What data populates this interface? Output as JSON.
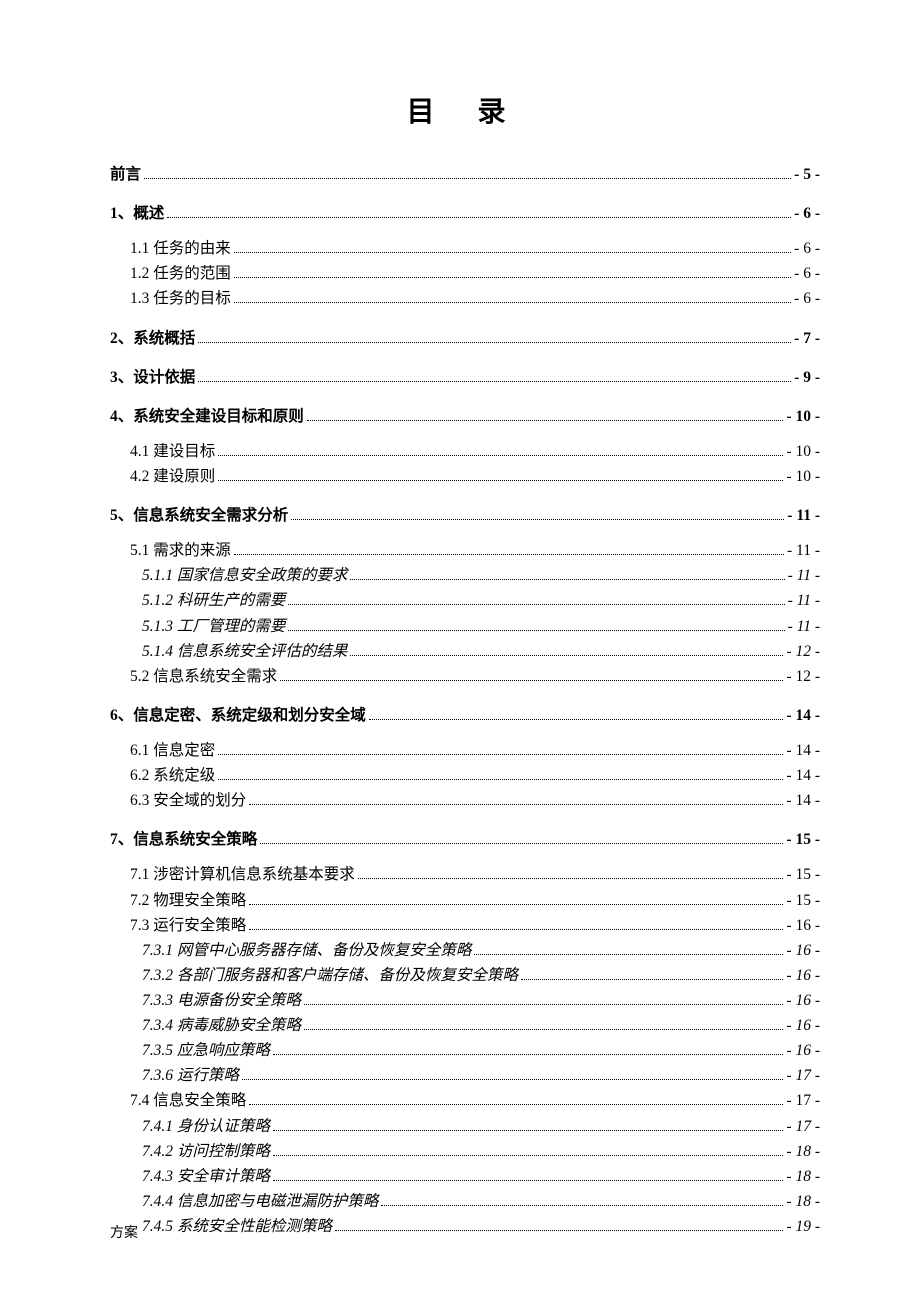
{
  "title": "目 录",
  "footer": "方案",
  "entries": [
    {
      "level": 0,
      "label": "前言",
      "page": "- 5 -",
      "gap": false
    },
    {
      "level": 0,
      "label": "1、概述",
      "page": "- 6 -",
      "gap": false
    },
    {
      "level": 1,
      "label": "1.1 任务的由来",
      "page": "- 6 -",
      "gap": true
    },
    {
      "level": 1,
      "label": "1.2 任务的范围",
      "page": "- 6 -",
      "gap": false
    },
    {
      "level": 1,
      "label": "1.3 任务的目标",
      "page": "- 6 -",
      "gap": false
    },
    {
      "level": 0,
      "label": "2、系统概括",
      "page": "- 7 -",
      "gap": false
    },
    {
      "level": 0,
      "label": "3、设计依据",
      "page": "- 9 -",
      "gap": false
    },
    {
      "level": 0,
      "label": "4、系统安全建设目标和原则",
      "page": "- 10 -",
      "gap": false
    },
    {
      "level": 1,
      "label": "4.1 建设目标",
      "page": "- 10 -",
      "gap": true
    },
    {
      "level": 1,
      "label": "4.2 建设原则",
      "page": "- 10 -",
      "gap": false
    },
    {
      "level": 0,
      "label": "5、信息系统安全需求分析",
      "page": "- 11 -",
      "gap": false
    },
    {
      "level": 1,
      "label": "5.1 需求的来源",
      "page": "- 11 -",
      "gap": true
    },
    {
      "level": 2,
      "label": "5.1.1 国家信息安全政策的要求",
      "page": "- 11 -",
      "gap": false
    },
    {
      "level": 2,
      "label": "5.1.2 科研生产的需要",
      "page": "- 11 -",
      "gap": false
    },
    {
      "level": 2,
      "label": "5.1.3 工厂管理的需要",
      "page": "- 11 -",
      "gap": false
    },
    {
      "level": 2,
      "label": "5.1.4 信息系统安全评估的结果",
      "page": "- 12 -",
      "gap": false
    },
    {
      "level": 1,
      "label": "5.2 信息系统安全需求",
      "page": "- 12 -",
      "gap": false
    },
    {
      "level": 0,
      "label": "6、信息定密、系统定级和划分安全域",
      "page": "- 14 -",
      "gap": false
    },
    {
      "level": 1,
      "label": "6.1 信息定密",
      "page": "- 14 -",
      "gap": true
    },
    {
      "level": 1,
      "label": "6.2 系统定级",
      "page": "- 14 -",
      "gap": false
    },
    {
      "level": 1,
      "label": "6.3 安全域的划分",
      "page": "- 14 -",
      "gap": false
    },
    {
      "level": 0,
      "label": "7、信息系统安全策略",
      "page": "- 15 -",
      "gap": false
    },
    {
      "level": 1,
      "label": "7.1 涉密计算机信息系统基本要求",
      "page": "- 15 -",
      "gap": true
    },
    {
      "level": 1,
      "label": "7.2 物理安全策略",
      "page": "- 15 -",
      "gap": false
    },
    {
      "level": 1,
      "label": "7.3 运行安全策略",
      "page": "- 16 -",
      "gap": false
    },
    {
      "level": 2,
      "label": "7.3.1 网管中心服务器存储、备份及恢复安全策略",
      "page": "- 16 -",
      "gap": false
    },
    {
      "level": 2,
      "label": "7.3.2 各部门服务器和客户端存储、备份及恢复安全策略",
      "page": "- 16 -",
      "gap": false
    },
    {
      "level": 2,
      "label": "7.3.3 电源备份安全策略",
      "page": "- 16 -",
      "gap": false
    },
    {
      "level": 2,
      "label": "7.3.4 病毒威胁安全策略",
      "page": "- 16 -",
      "gap": false
    },
    {
      "level": 2,
      "label": "7.3.5 应急响应策略",
      "page": "- 16 -",
      "gap": false
    },
    {
      "level": 2,
      "label": "7.3.6 运行策略",
      "page": "- 17 -",
      "gap": false
    },
    {
      "level": 1,
      "label": "7.4 信息安全策略",
      "page": "- 17 -",
      "gap": false
    },
    {
      "level": 2,
      "label": "7.4.1 身份认证策略",
      "page": "- 17 -",
      "gap": false
    },
    {
      "level": 2,
      "label": "7.4.2 访问控制策略",
      "page": "- 18 -",
      "gap": false
    },
    {
      "level": 2,
      "label": "7.4.3 安全审计策略",
      "page": "- 18 -",
      "gap": false
    },
    {
      "level": 2,
      "label": "7.4.4 信息加密与电磁泄漏防护策略",
      "page": "- 18 -",
      "gap": false
    },
    {
      "level": 2,
      "label": "7.4.5 系统安全性能检测策略",
      "page": "- 19 -",
      "gap": false
    }
  ]
}
